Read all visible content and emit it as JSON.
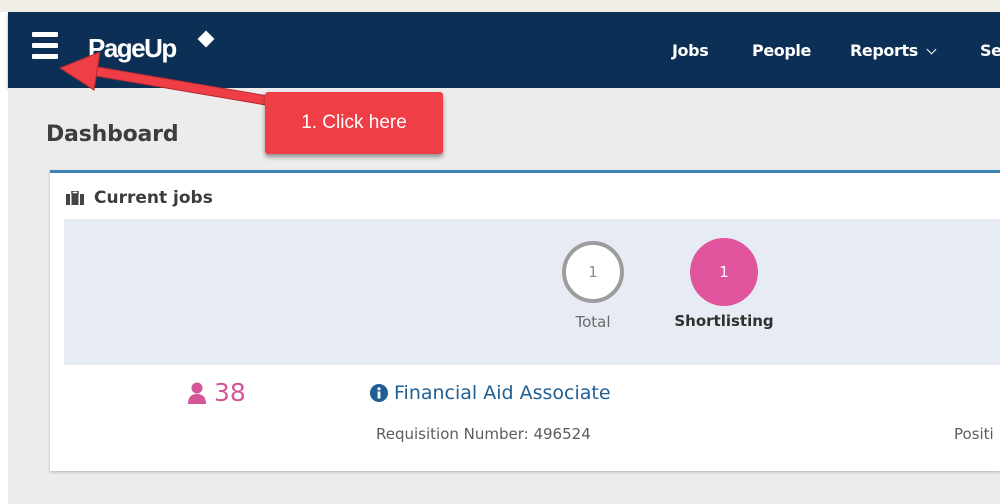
{
  "app": {
    "logo_text": "PageUp",
    "nav": [
      {
        "label": "Jobs"
      },
      {
        "label": "People"
      },
      {
        "label": "Reports"
      },
      {
        "label": "Se"
      }
    ]
  },
  "page": {
    "title": "Dashboard"
  },
  "card": {
    "title": "Current jobs",
    "stats": {
      "total": {
        "value": "1",
        "label": "Total"
      },
      "shortlisting": {
        "value": "1",
        "label": "Shortlisting"
      }
    },
    "job": {
      "applicants": "38",
      "title": "Financial Aid Associate",
      "requisition": "Requisition Number: 496524",
      "position_cut": "Positi"
    }
  },
  "annotation": {
    "callout_text": "1. Click here"
  },
  "colors": {
    "navbar": "#0c2f55",
    "accent_pink": "#e0559e",
    "link_blue": "#1f5f93",
    "callout_red": "#ef3e46"
  },
  "icons": [
    "hamburger-menu-icon",
    "logo-diamond-icon",
    "chevron-down-icon",
    "briefcase-icon",
    "person-icon",
    "info-icon"
  ]
}
